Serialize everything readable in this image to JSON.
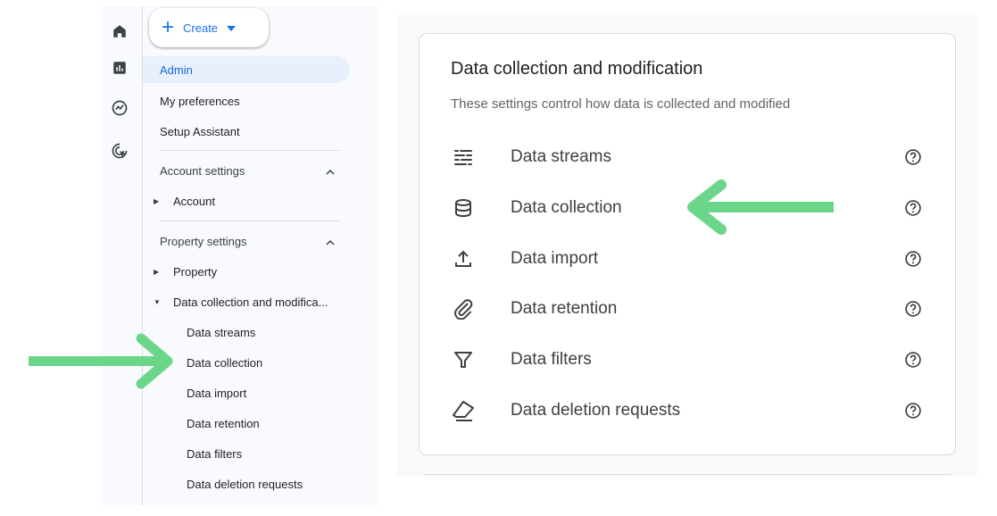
{
  "sidebar": {
    "rail_icons": [
      "home-icon",
      "reports-icon",
      "explore-icon",
      "advertising-icon"
    ],
    "create_label": "Create",
    "top_items": [
      {
        "label": "Admin",
        "active": true
      },
      {
        "label": "My preferences"
      },
      {
        "label": "Setup Assistant"
      }
    ],
    "account_section": {
      "label": "Account settings",
      "items": [
        {
          "label": "Account"
        }
      ]
    },
    "property_section": {
      "label": "Property settings",
      "items": [
        {
          "label": "Property"
        },
        {
          "label": "Data collection and modifica..."
        }
      ],
      "subitems": [
        {
          "label": "Data streams"
        },
        {
          "label": "Data collection"
        },
        {
          "label": "Data import"
        },
        {
          "label": "Data retention"
        },
        {
          "label": "Data filters"
        },
        {
          "label": "Data deletion requests"
        }
      ]
    }
  },
  "card": {
    "title": "Data collection and modification",
    "subtitle": "These settings control how data is collected and modified",
    "rows": [
      {
        "label": "Data streams",
        "icon": "data-streams-icon"
      },
      {
        "label": "Data collection",
        "icon": "database-icon"
      },
      {
        "label": "Data import",
        "icon": "upload-icon"
      },
      {
        "label": "Data retention",
        "icon": "paperclip-icon"
      },
      {
        "label": "Data filters",
        "icon": "filter-icon"
      },
      {
        "label": "Data deletion requests",
        "icon": "eraser-icon"
      }
    ]
  },
  "colors": {
    "accent": "#1a73e8",
    "active_bg": "#e8f0fe",
    "annotation_arrow": "#6bd68a"
  }
}
